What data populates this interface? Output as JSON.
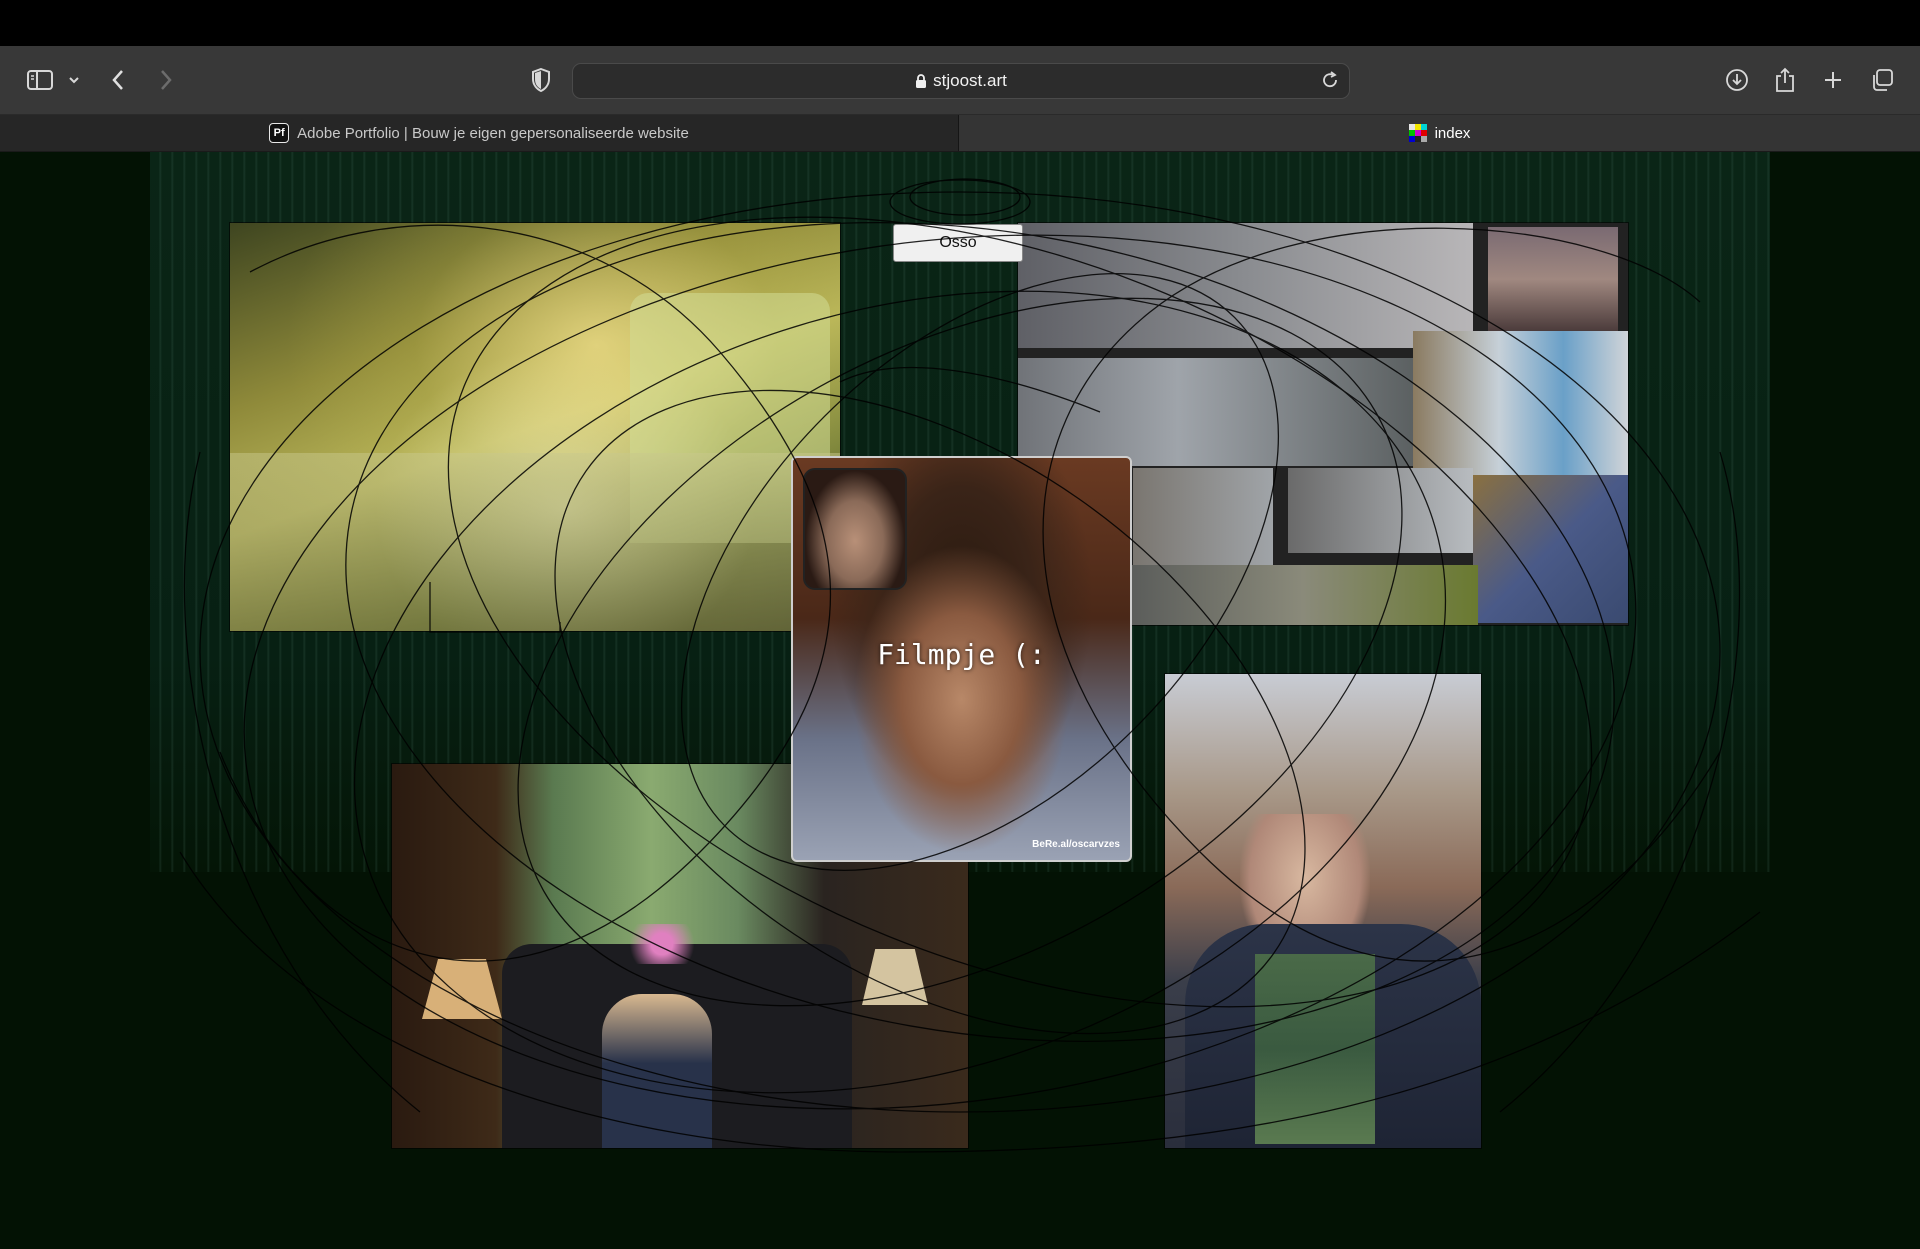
{
  "browser": {
    "address": "stjoost.art",
    "tabs": [
      {
        "title": "Adobe Portfolio | Bouw je eigen gepersonaliseerde website",
        "favicon": "pf-icon",
        "active": false
      },
      {
        "title": "index",
        "favicon": "color-bars-icon",
        "active": true
      }
    ],
    "icons": {
      "sidebar": "sidebar-icon",
      "back": "chevron-left-icon",
      "forward": "chevron-right-icon",
      "privacy": "shield-icon",
      "reload": "reload-icon",
      "download": "download-icon",
      "share": "share-icon",
      "new_tab": "plus-icon",
      "tab_overview": "tabs-icon"
    }
  },
  "page": {
    "osso_button": "Osso",
    "video": {
      "title": "Filmpje (:",
      "caption": "BeRe.al/oscarvzes"
    },
    "background_color": "#031204"
  }
}
